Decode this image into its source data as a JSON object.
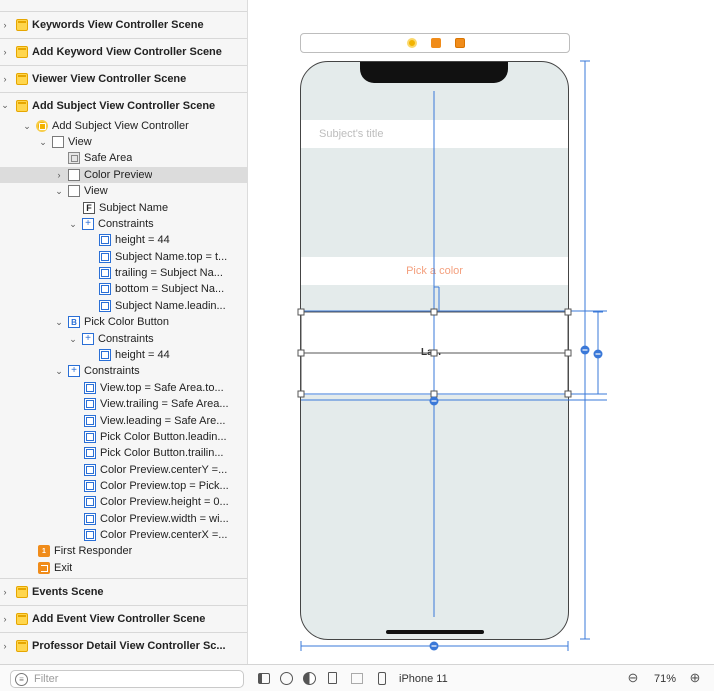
{
  "outline": {
    "scenes_top": [
      {
        "label": "Keywords View Controller Scene"
      },
      {
        "label": "Add Keyword View Controller Scene"
      },
      {
        "label": "Viewer View Controller Scene"
      }
    ],
    "open_scene": {
      "label": "Add Subject View Controller Scene",
      "controller": "Add Subject View Controller",
      "view": "View",
      "safe_area": "Safe Area",
      "color_preview": "Color Preview",
      "inner_view": "View",
      "subject_name": "Subject Name",
      "constraints": "Constraints",
      "inner_constraints": [
        "height = 44",
        "Subject Name.top = t...",
        "trailing = Subject Na...",
        "bottom = Subject Na...",
        "Subject Name.leadin..."
      ],
      "pick_color_button": "Pick Color Button",
      "button_constraints": [
        "height = 44"
      ],
      "view_constraints": [
        "View.top = Safe Area.to...",
        "View.trailing = Safe Area...",
        "View.leading = Safe Are...",
        "Pick Color Button.leadin...",
        "Pick Color Button.trailin...",
        "Color Preview.centerY =...",
        "Color Preview.top = Pick...",
        "Color Preview.height = 0...",
        "Color Preview.width = wi...",
        "Color Preview.centerX =..."
      ],
      "first_responder": "First Responder",
      "exit": "Exit"
    },
    "scenes_bottom": [
      {
        "label": "Events Scene"
      },
      {
        "label": "Add Event View Controller Scene"
      },
      {
        "label": "Professor Detail View Controller Sc..."
      }
    ]
  },
  "canvas": {
    "subject_placeholder": "Subject's title",
    "pick_color": "Pick a color",
    "label_text": "La..."
  },
  "bottom_bar": {
    "filter_placeholder": "Filter",
    "device": "iPhone 11",
    "zoom": "71%"
  },
  "colors": {
    "accent": "#2a6fd6",
    "pick_color_text": "#f4a07e",
    "phone_bg": "#e4ebeb",
    "scene_icon": "#ffd64d"
  }
}
